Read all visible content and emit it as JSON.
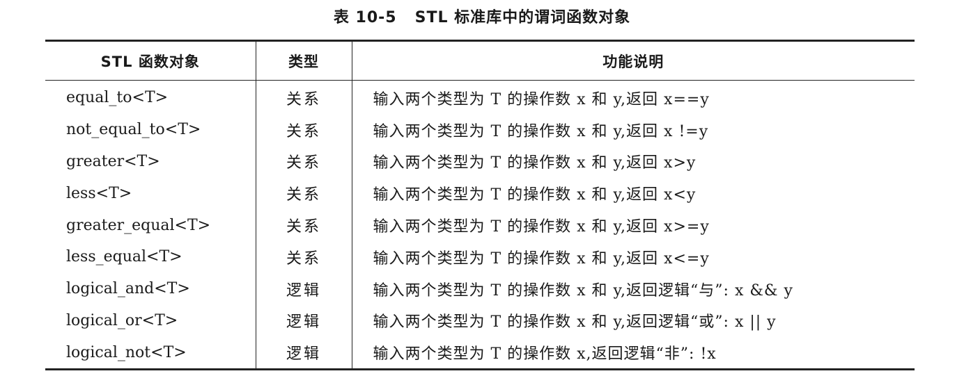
{
  "caption": {
    "number": "表 10-5",
    "title": "STL 标准库中的谓词函数对象"
  },
  "table": {
    "headers": [
      "STL 函数对象",
      "类型",
      "功能说明"
    ],
    "rows": [
      {
        "name": "equal_to<T>",
        "type": "关系",
        "desc": "输入两个类型为 T 的操作数 x 和 y,返回 x==y"
      },
      {
        "name": "not_equal_to<T>",
        "type": "关系",
        "desc": "输入两个类型为 T 的操作数 x 和 y,返回 x !=y"
      },
      {
        "name": "greater<T>",
        "type": "关系",
        "desc": "输入两个类型为 T 的操作数 x 和 y,返回 x>y"
      },
      {
        "name": "less<T>",
        "type": "关系",
        "desc": "输入两个类型为 T 的操作数 x 和 y,返回 x<y"
      },
      {
        "name": "greater_equal<T>",
        "type": "关系",
        "desc": "输入两个类型为 T 的操作数 x 和 y,返回 x>=y"
      },
      {
        "name": "less_equal<T>",
        "type": "关系",
        "desc": "输入两个类型为 T 的操作数 x 和 y,返回 x<=y"
      },
      {
        "name": "logical_and<T>",
        "type": "逻辑",
        "desc": "输入两个类型为 T 的操作数 x 和 y,返回逻辑“与”: x && y"
      },
      {
        "name": "logical_or<T>",
        "type": "逻辑",
        "desc": "输入两个类型为 T 的操作数 x 和 y,返回逻辑“或”: x || y"
      },
      {
        "name": "logical_not<T>",
        "type": "逻辑",
        "desc": "输入两个类型为 T 的操作数 x,返回逻辑“非”: !x"
      }
    ]
  }
}
